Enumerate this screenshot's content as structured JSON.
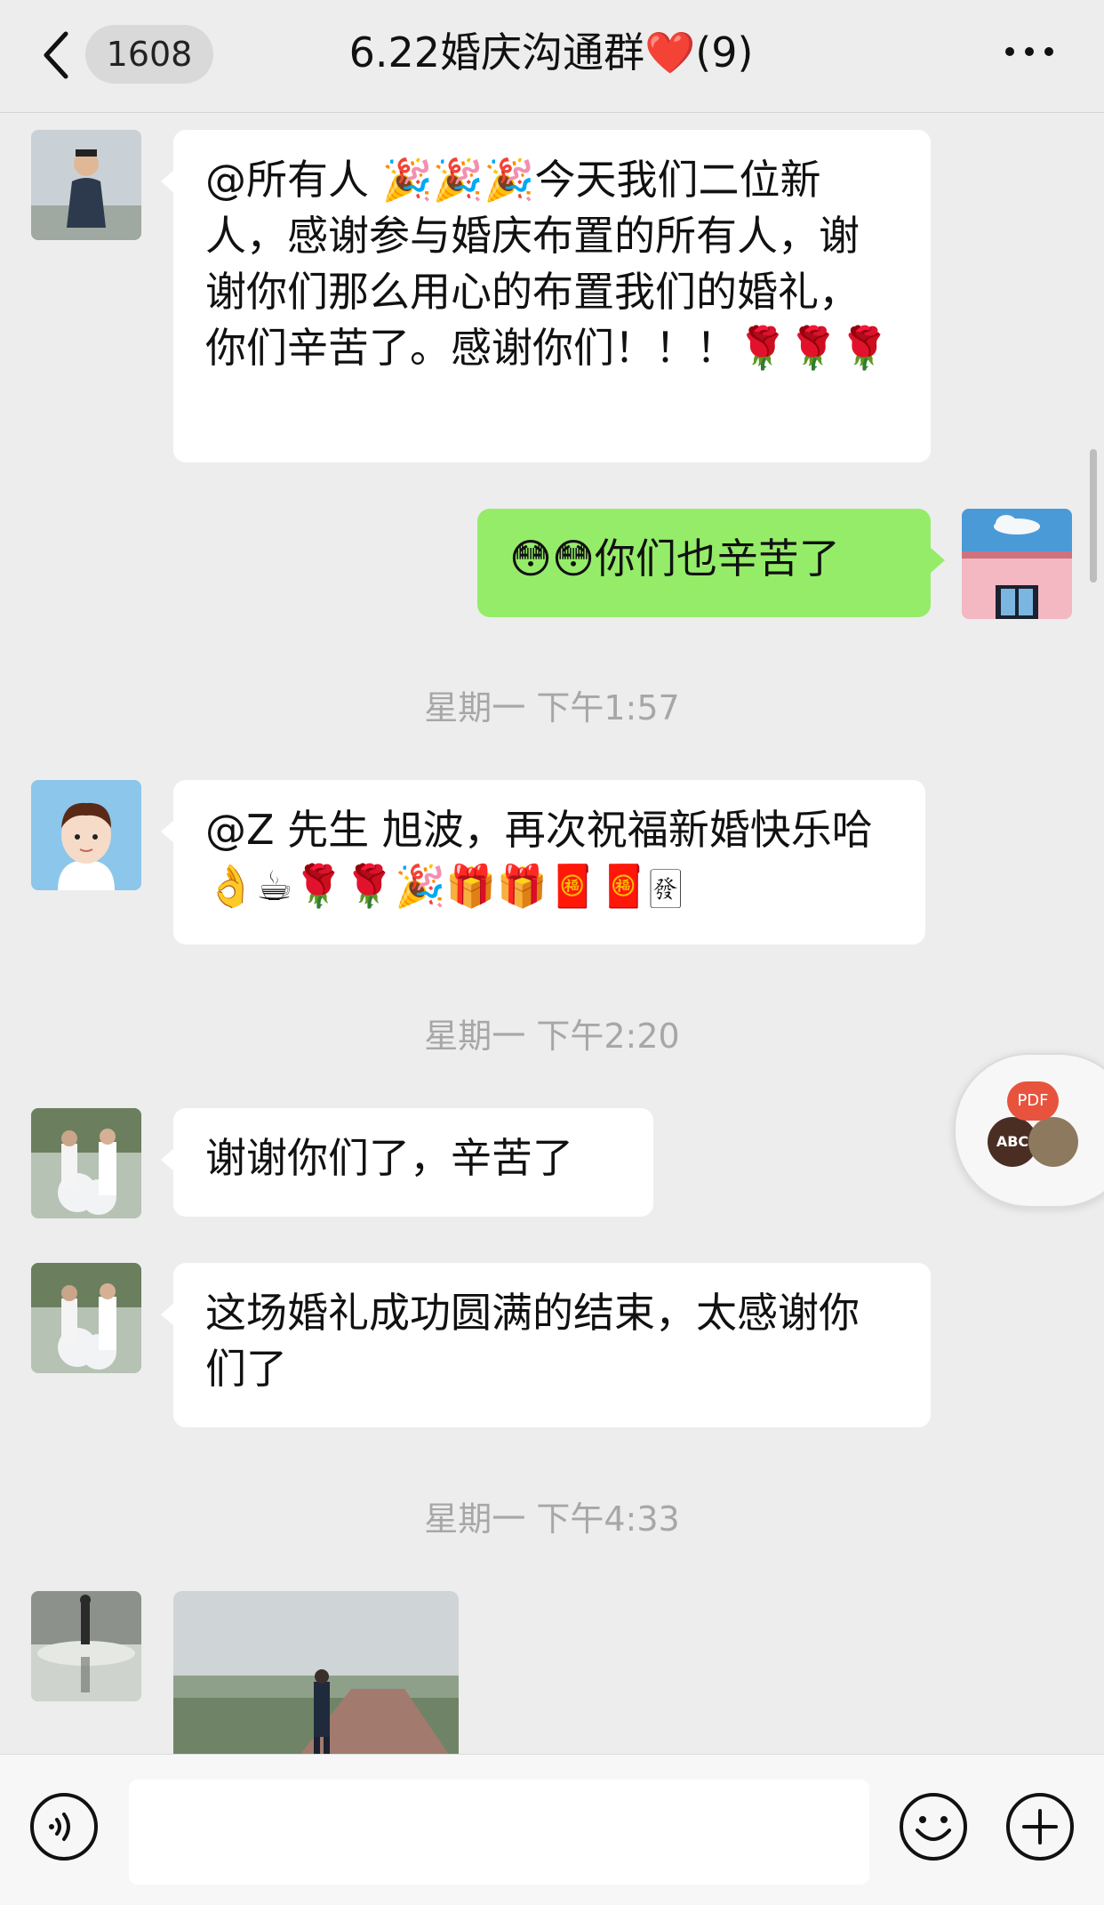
{
  "header": {
    "back_count": "1608",
    "title": "6.22婚庆沟通群❤️(9)"
  },
  "messages": [
    {
      "type": "text",
      "from": "other",
      "text": "@所有人 🎉🎉🎉今天我们二位新人，感谢参与婚庆布置的所有人，谢谢你们那么用心的布置我们的婚礼，你们辛苦了。感谢你们！！！🌹🌹🌹"
    },
    {
      "type": "text",
      "from": "me",
      "text": "😳😳你们也辛苦了"
    },
    {
      "type": "time",
      "text": "星期一 下午1:57"
    },
    {
      "type": "text",
      "from": "other",
      "text": "@Z 先生 旭波，再次祝福新婚快乐哈👌☕🌹🌹🎉🎁🎁🧧🧧🀅"
    },
    {
      "type": "time",
      "text": "星期一 下午2:20"
    },
    {
      "type": "text",
      "from": "other",
      "text": "谢谢你们了，辛苦了"
    },
    {
      "type": "text",
      "from": "other",
      "text": "这场婚礼成功圆满的结束，太感谢你们了"
    },
    {
      "type": "time",
      "text": "星期一 下午4:33"
    },
    {
      "type": "image",
      "from": "other"
    }
  ],
  "float": {
    "badge": "PDF",
    "label": "ABC"
  },
  "input": {
    "placeholder": ""
  },
  "colors": {
    "my_bubble": "#95ec69",
    "other_bubble": "#ffffff",
    "background": "#ededed"
  }
}
